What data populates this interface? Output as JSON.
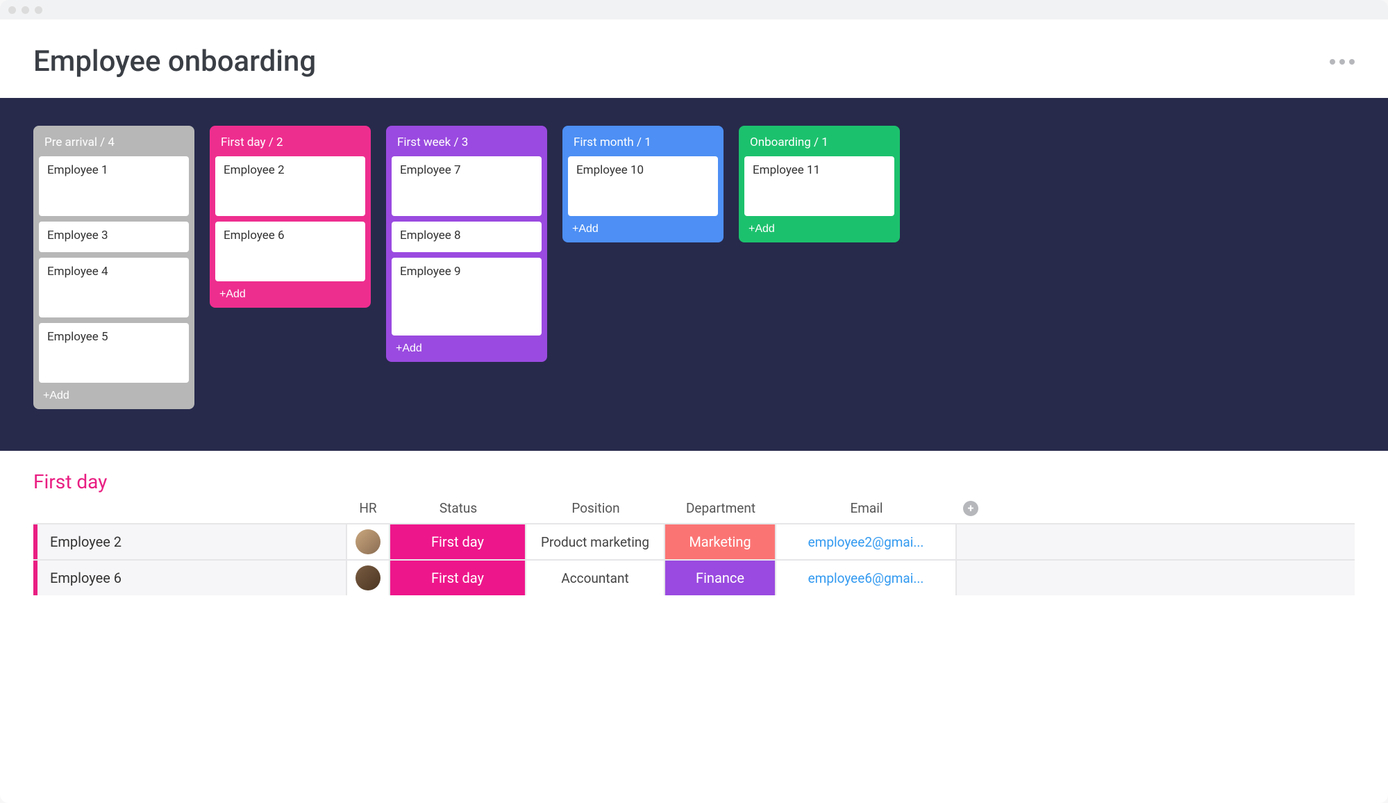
{
  "page_title": "Employee onboarding",
  "add_label": "+Add",
  "columns": [
    {
      "title": "Pre arrival / 4",
      "color": "#b7b7b7",
      "cards": [
        {
          "name": "Employee 1",
          "h": "tall"
        },
        {
          "name": "Employee 3",
          "h": ""
        },
        {
          "name": "Employee 4",
          "h": "tall"
        },
        {
          "name": "Employee 5",
          "h": "tall"
        }
      ]
    },
    {
      "title": "First day / 2",
      "color": "#ee2e8f",
      "cards": [
        {
          "name": "Employee 2",
          "h": "tall"
        },
        {
          "name": "Employee 6",
          "h": "tall"
        }
      ]
    },
    {
      "title": "First week / 3",
      "color": "#9a4ae0",
      "cards": [
        {
          "name": "Employee 7",
          "h": "tall"
        },
        {
          "name": "Employee 8",
          "h": ""
        },
        {
          "name": "Employee 9",
          "h": "taller"
        }
      ]
    },
    {
      "title": "First month / 1",
      "color": "#4d8ff4",
      "cards": [
        {
          "name": "Employee 10",
          "h": "tall"
        }
      ]
    },
    {
      "title": "Onboarding / 1",
      "color": "#1cc16d",
      "cards": [
        {
          "name": "Employee 11",
          "h": "tall"
        }
      ]
    }
  ],
  "table": {
    "group_title": "First day",
    "headers": {
      "hr": "HR",
      "status": "Status",
      "position": "Position",
      "department": "Department",
      "email": "Email"
    },
    "rows": [
      {
        "name": "Employee 2",
        "status": "First day",
        "status_color": "#ee168b",
        "position": "Product marketing",
        "department": "Marketing",
        "dept_color": "#fb7474",
        "email": "employee2@gmai...",
        "avatar_class": ""
      },
      {
        "name": "Employee 6",
        "status": "First day",
        "status_color": "#ee168b",
        "position": "Accountant",
        "department": "Finance",
        "dept_color": "#9a4ae0",
        "email": "employee6@gmai...",
        "avatar_class": "b"
      }
    ]
  }
}
